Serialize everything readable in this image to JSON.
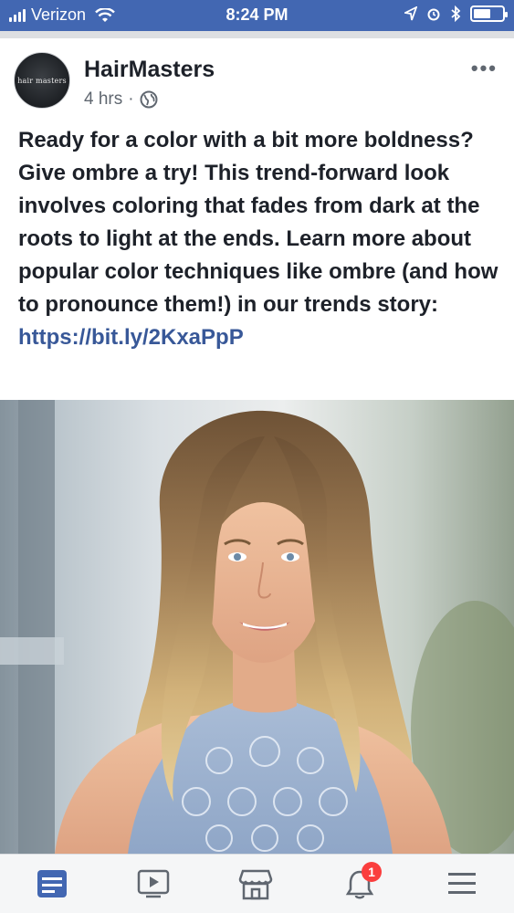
{
  "status_bar": {
    "carrier": "Verizon",
    "time": "8:24 PM",
    "icons": [
      "signal-icon",
      "wifi-icon",
      "location-icon",
      "alarm-icon",
      "bluetooth-icon",
      "battery-icon"
    ],
    "battery_level": 0.6
  },
  "post": {
    "page_name": "HairMasters",
    "avatar_text": "hair masters",
    "time_ago": "4 hrs",
    "separator": "·",
    "privacy_icon": "globe-icon",
    "more_label": "•••",
    "text": "Ready for a color with a bit more boldness? Give ombre a try! This trend-forward look involves coloring that fades from dark at the roots to light at the ends. Learn more about popular color techniques like ombre (and how to pronounce them!) in our trends story: ",
    "link": "https://bit.ly/2KxaPpP",
    "photo_alt": "woman with ombre hair"
  },
  "nav": {
    "items": [
      {
        "name": "news-feed-icon",
        "active": true
      },
      {
        "name": "watch-icon",
        "active": false
      },
      {
        "name": "marketplace-icon",
        "active": false
      },
      {
        "name": "notifications-icon",
        "active": false,
        "badge": "1"
      },
      {
        "name": "menu-icon",
        "active": false
      }
    ]
  },
  "colors": {
    "brand": "#4267b2",
    "link": "#385898",
    "badge": "#fa3e3e"
  }
}
